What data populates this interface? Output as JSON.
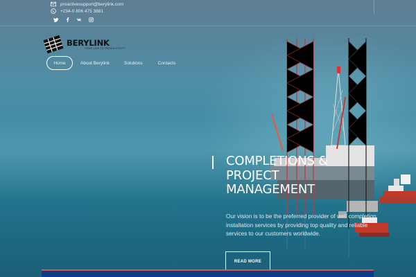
{
  "topbar": {
    "email": "proactivesupport@berylink.com",
    "phone": "+234-0 806 475 3881",
    "social": [
      {
        "icon": "twitter-icon"
      },
      {
        "icon": "facebook-icon"
      },
      {
        "icon": "vk-icon"
      },
      {
        "icon": "instagram-icon"
      }
    ]
  },
  "logo": {
    "name": "BERYLINK",
    "tagline": "YOUR LINK TO PRODUCTIVITY"
  },
  "nav": {
    "items": [
      {
        "label": "Home",
        "active": true
      },
      {
        "label": "About Berylink"
      },
      {
        "label": "Solutions"
      },
      {
        "label": "Contacts"
      }
    ]
  },
  "hero": {
    "title_lines": [
      "COMPLETIONS &",
      "PROJECT",
      "MANAGEMENT"
    ],
    "description": "Our vision is to be the preferred provider of well completion installation services by providing top quality and reliable services to our customers worldwide.",
    "button_label": "READ MORE"
  },
  "colors": {
    "accent": "#0e3a8c",
    "accent_red": "#d9534f",
    "sea": "#2e7f98"
  }
}
